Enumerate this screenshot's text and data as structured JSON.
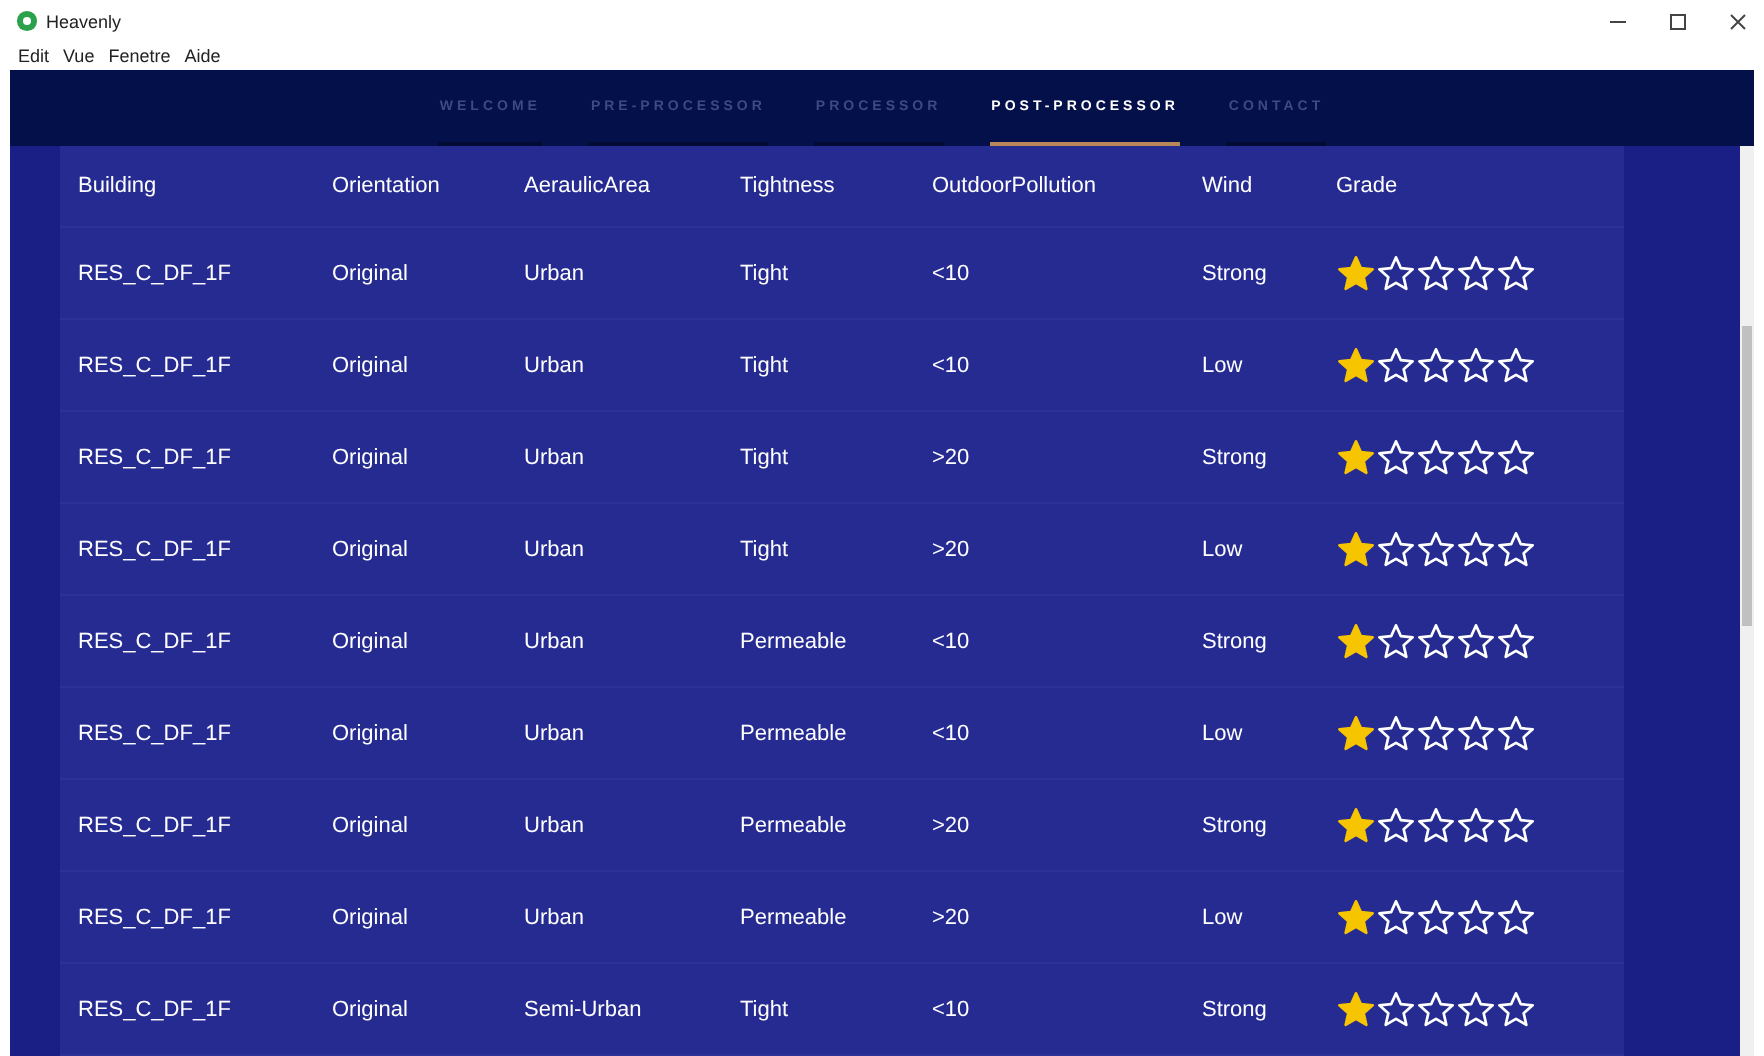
{
  "window": {
    "title": "Heavenly"
  },
  "menu": [
    "Edit",
    "Vue",
    "Fenetre",
    "Aide"
  ],
  "nav": [
    {
      "label": "WELCOME",
      "selected": false
    },
    {
      "label": "PRE-PROCESSOR",
      "selected": false
    },
    {
      "label": "PROCESSOR",
      "selected": false
    },
    {
      "label": "POST-PROCESSOR",
      "selected": true
    },
    {
      "label": "CONTACT",
      "selected": false
    }
  ],
  "table": {
    "columns": [
      "Building",
      "Orientation",
      "AeraulicArea",
      "Tightness",
      "OutdoorPollution",
      "Wind",
      "Grade"
    ],
    "rows": [
      {
        "cells": [
          "RES_C_DF_1F",
          "Original",
          "Urban",
          "Tight",
          "<10",
          "Strong"
        ],
        "stars": 1
      },
      {
        "cells": [
          "RES_C_DF_1F",
          "Original",
          "Urban",
          "Tight",
          "<10",
          "Low"
        ],
        "stars": 1
      },
      {
        "cells": [
          "RES_C_DF_1F",
          "Original",
          "Urban",
          "Tight",
          ">20",
          "Strong"
        ],
        "stars": 1
      },
      {
        "cells": [
          "RES_C_DF_1F",
          "Original",
          "Urban",
          "Tight",
          ">20",
          "Low"
        ],
        "stars": 1
      },
      {
        "cells": [
          "RES_C_DF_1F",
          "Original",
          "Urban",
          "Permeable",
          "<10",
          "Strong"
        ],
        "stars": 1
      },
      {
        "cells": [
          "RES_C_DF_1F",
          "Original",
          "Urban",
          "Permeable",
          "<10",
          "Low"
        ],
        "stars": 1
      },
      {
        "cells": [
          "RES_C_DF_1F",
          "Original",
          "Urban",
          "Permeable",
          ">20",
          "Strong"
        ],
        "stars": 1
      },
      {
        "cells": [
          "RES_C_DF_1F",
          "Original",
          "Urban",
          "Permeable",
          ">20",
          "Low"
        ],
        "stars": 1
      },
      {
        "cells": [
          "RES_C_DF_1F",
          "Original",
          "Semi-Urban",
          "Tight",
          "<10",
          "Strong"
        ],
        "stars": 1
      }
    ]
  }
}
